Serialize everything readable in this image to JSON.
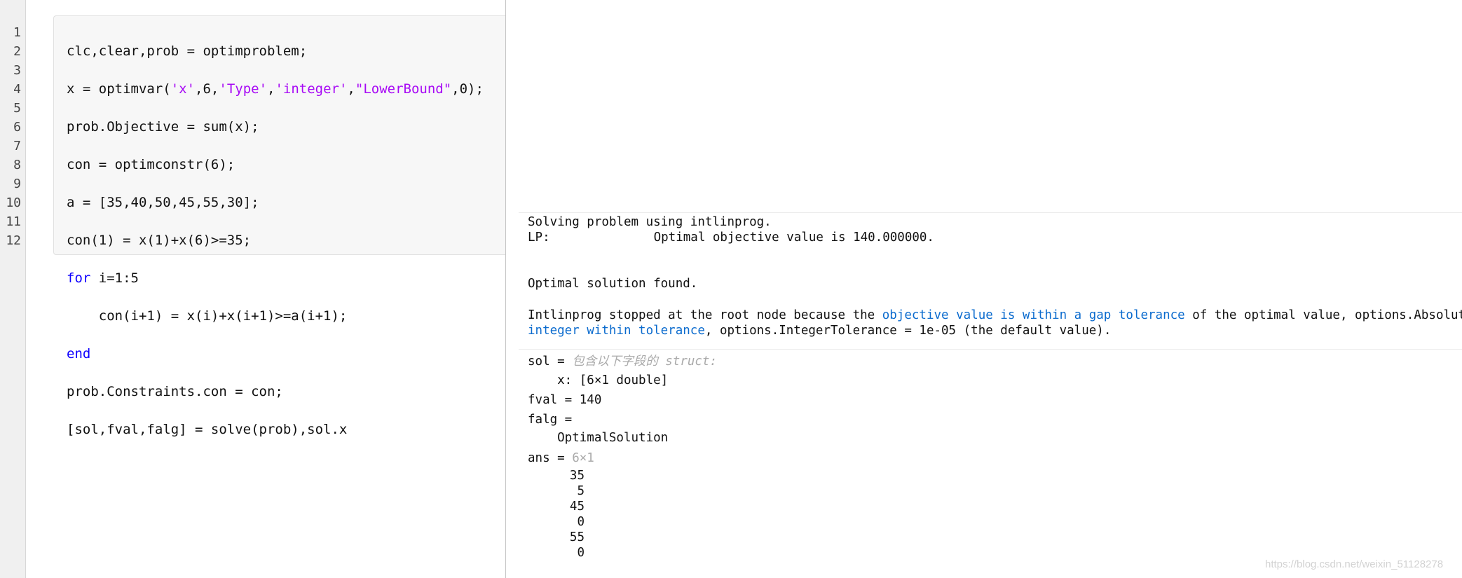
{
  "editor": {
    "line_numbers": [
      "1",
      "2",
      "3",
      "4",
      "5",
      "6",
      "7",
      "8",
      "9",
      "10",
      "11",
      "12"
    ],
    "lines": [
      [
        "clc,clear,prob = optimproblem;"
      ],
      [
        "x = optimvar(",
        "'x'",
        ",6,",
        "'Type'",
        ",",
        "'integer'",
        ",",
        "\"LowerBound\"",
        ",0);"
      ],
      [
        "prob.Objective = sum(x);"
      ],
      [
        "con = optimconstr(6);"
      ],
      [
        "a = [35,40,50,45,55,30];"
      ],
      [
        "con(1) = x(1)+x(6)>=35;"
      ],
      [
        "for",
        " i=1:5"
      ],
      [
        "    con(i+1) = x(i)+x(i+1)>=a(i+1);"
      ],
      [
        "end"
      ],
      [
        "prob.Constraints.con = con;"
      ],
      [
        "[sol,fval,falg] = solve(prob),sol.x"
      ]
    ]
  },
  "output": {
    "solving": "Solving problem using intlinprog.",
    "lp_label": "LP:",
    "lp_value": "Optimal objective value is 140.000000.",
    "found": "Optimal solution found.",
    "stop_1a": "Intlinprog stopped at the root node because the ",
    "stop_link1": "objective value is within a gap tolerance",
    "stop_1b": " of the optimal value, options.AbsoluteGapTol",
    "stop_link2": "integer within tolerance",
    "stop_2b": ", options.IntegerTolerance = 1e-05 (the default value).",
    "sol_label": "sol = ",
    "sol_desc": "包含以下字段的 struct:",
    "sol_field": "    x: [6×1 double]",
    "fval": "fval = 140",
    "falg_label": "falg = ",
    "falg_value": "    OptimalSolution",
    "ans_label": "ans = ",
    "ans_size": "6×1",
    "ans_values": [
      "35",
      "5",
      "45",
      "0",
      "55",
      "0"
    ]
  },
  "watermark": "https://blog.csdn.net/weixin_51128278",
  "colors": {
    "string": "#a709f5",
    "keyword": "#0e00ff",
    "link": "#0b6bce"
  }
}
